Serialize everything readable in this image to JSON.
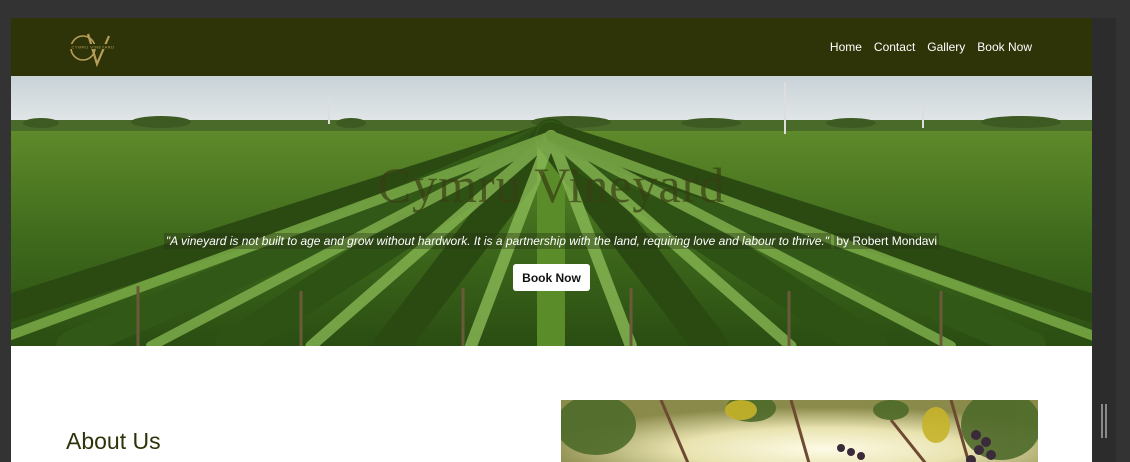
{
  "brand": {
    "monogram": "CV",
    "logo_text": "CYMRU VINEYARD",
    "accent": "#b79d5a"
  },
  "nav": {
    "items": [
      {
        "label": "Home"
      },
      {
        "label": "Contact"
      },
      {
        "label": "Gallery"
      },
      {
        "label": "Book Now"
      }
    ],
    "background": "#2e3408"
  },
  "hero": {
    "title": "Cymru Vineyard",
    "quote": "\"A vineyard is not built to age and grow without hardwork. It is a partnership with the land, requiring love and labour to thrive.\"",
    "attribution": "by Robert Mondavi",
    "button_label": "Book Now"
  },
  "about": {
    "title": "About Us"
  },
  "colors": {
    "page_bg": "#333333",
    "content_bg": "#ffffff",
    "heading": "#2e3408"
  }
}
